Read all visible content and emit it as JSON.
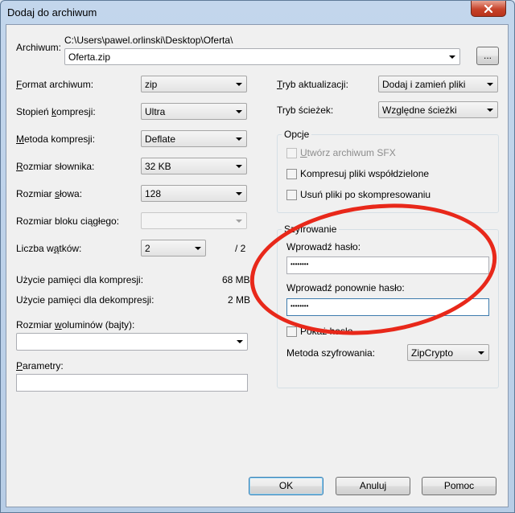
{
  "window": {
    "title": "Dodaj do archiwum"
  },
  "archive": {
    "label": "Archiwum:",
    "path": "C:\\Users\\pawel.orlinski\\Desktop\\Oferta\\",
    "filename": "Oferta.zip",
    "browse_label": "..."
  },
  "left": {
    "format_label": "Format archiwum:",
    "format_value": "zip",
    "level_label": "Stopień kompresji:",
    "level_value": "Ultra",
    "method_label": "Metoda kompresji:",
    "method_value": "Deflate",
    "dict_label": "Rozmiar słownika:",
    "dict_value": "32 KB",
    "word_label": "Rozmiar słowa:",
    "word_value": "128",
    "solid_label": "Rozmiar bloku ciągłego:",
    "solid_value": "",
    "threads_label": "Liczba wątków:",
    "threads_value": "2",
    "threads_max": "/ 2",
    "mem_comp_label": "Użycie pamięci dla kompresji:",
    "mem_comp_value": "68 MB",
    "mem_decomp_label": "Użycie pamięci dla dekompresji:",
    "mem_decomp_value": "2 MB",
    "volumes_label": "Rozmiar woluminów (bajty):",
    "volumes_value": "",
    "params_label": "Parametry:",
    "params_value": ""
  },
  "right": {
    "update_label": "Tryb aktualizacji:",
    "update_value": "Dodaj i zamień pliki",
    "paths_label": "Tryb ścieżek:",
    "paths_value": "Względne ścieżki",
    "options_title": "Opcje",
    "sfx_label": "Utwórz archiwum SFX",
    "shared_label": "Kompresuj pliki współdzielone",
    "delete_label": "Usuń pliki po skompresowaniu",
    "encryption_title": "Szyfrowanie",
    "password_label": "Wprowadź hasło:",
    "password_value": "••••••••",
    "repeat_label": "Wprowadź ponownie hasło:",
    "repeat_value": "••••••••",
    "show_password_label": "Pokaż hasło",
    "enc_method_label": "Metoda szyfrowania:",
    "enc_method_value": "ZipCrypto"
  },
  "buttons": {
    "ok": "OK",
    "cancel": "Anuluj",
    "help": "Pomoc"
  },
  "colors": {
    "annotation": "#e8281a",
    "default_button_border": "#3c7fb1"
  }
}
